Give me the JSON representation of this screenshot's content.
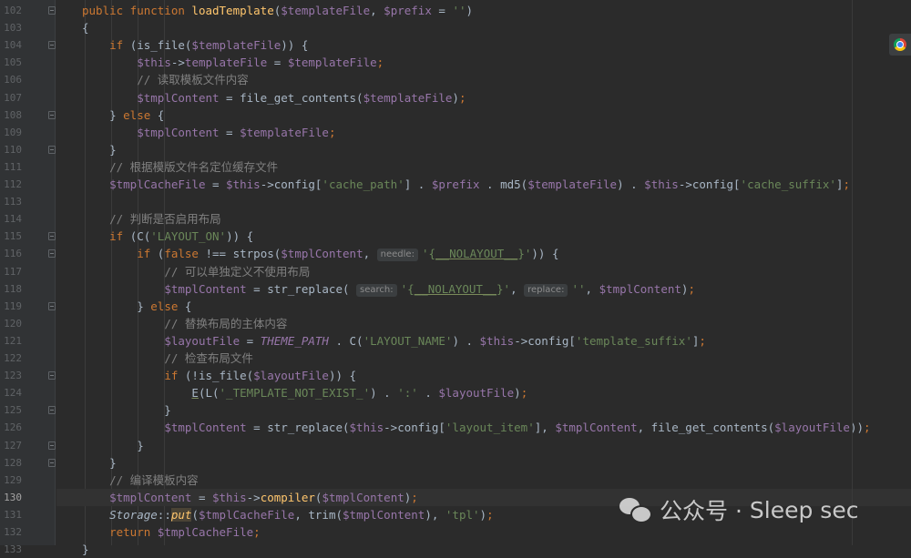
{
  "editor": {
    "current_line": "130",
    "lines": [
      {
        "num": "102",
        "fold": true,
        "tokens": [
          [
            "k",
            "public function "
          ],
          [
            "f",
            "loadTemplate"
          ],
          [
            "p",
            "("
          ],
          [
            "v",
            "$templateFile"
          ],
          [
            "p",
            ", "
          ],
          [
            "v",
            "$prefix"
          ],
          [
            "p",
            " = "
          ],
          [
            "s",
            "''"
          ],
          [
            "p",
            ")"
          ]
        ]
      },
      {
        "num": "103",
        "tokens": [
          [
            "p",
            "{"
          ]
        ]
      },
      {
        "num": "104",
        "fold": true,
        "tokens": [
          [
            "p",
            "    "
          ],
          [
            "k",
            "if "
          ],
          [
            "p",
            "(is_file("
          ],
          [
            "v",
            "$templateFile"
          ],
          [
            "p",
            ")) {"
          ]
        ]
      },
      {
        "num": "105",
        "tokens": [
          [
            "p",
            "        "
          ],
          [
            "v",
            "$this"
          ],
          [
            "p",
            "->"
          ],
          [
            "v",
            "templateFile"
          ],
          [
            "p",
            " = "
          ],
          [
            "v",
            "$templateFile"
          ],
          [
            "k",
            ";"
          ]
        ]
      },
      {
        "num": "106",
        "tokens": [
          [
            "p",
            "        "
          ],
          [
            "c",
            "// 读取模板文件内容"
          ]
        ]
      },
      {
        "num": "107",
        "tokens": [
          [
            "p",
            "        "
          ],
          [
            "v",
            "$tmplContent"
          ],
          [
            "p",
            " = file_get_contents("
          ],
          [
            "v",
            "$templateFile"
          ],
          [
            "p",
            ")"
          ],
          [
            "k",
            ";"
          ]
        ]
      },
      {
        "num": "108",
        "fold": true,
        "tokens": [
          [
            "p",
            "    } "
          ],
          [
            "k",
            "else "
          ],
          [
            "p",
            "{"
          ]
        ]
      },
      {
        "num": "109",
        "tokens": [
          [
            "p",
            "        "
          ],
          [
            "v",
            "$tmplContent"
          ],
          [
            "p",
            " = "
          ],
          [
            "v",
            "$templateFile"
          ],
          [
            "k",
            ";"
          ]
        ]
      },
      {
        "num": "110",
        "fold": true,
        "tokens": [
          [
            "p",
            "    }"
          ]
        ]
      },
      {
        "num": "111",
        "tokens": [
          [
            "p",
            "    "
          ],
          [
            "c",
            "// 根据模版文件名定位缓存文件"
          ]
        ]
      },
      {
        "num": "112",
        "tokens": [
          [
            "p",
            "    "
          ],
          [
            "v",
            "$tmplCacheFile"
          ],
          [
            "p",
            " = "
          ],
          [
            "v",
            "$this"
          ],
          [
            "p",
            "->config["
          ],
          [
            "s",
            "'cache_path'"
          ],
          [
            "p",
            "] . "
          ],
          [
            "v",
            "$prefix"
          ],
          [
            "p",
            " . md5("
          ],
          [
            "v",
            "$templateFile"
          ],
          [
            "p",
            ") . "
          ],
          [
            "v",
            "$this"
          ],
          [
            "p",
            "->config["
          ],
          [
            "s",
            "'cache_suffix'"
          ],
          [
            "p",
            "]"
          ],
          [
            "k",
            ";"
          ]
        ]
      },
      {
        "num": "113",
        "tokens": []
      },
      {
        "num": "114",
        "tokens": [
          [
            "p",
            "    "
          ],
          [
            "c",
            "// 判断是否启用布局"
          ]
        ]
      },
      {
        "num": "115",
        "fold": true,
        "tokens": [
          [
            "p",
            "    "
          ],
          [
            "k",
            "if "
          ],
          [
            "p",
            "(C("
          ],
          [
            "s",
            "'LAYOUT_ON'"
          ],
          [
            "p",
            ")) {"
          ]
        ]
      },
      {
        "num": "116",
        "fold": true,
        "tokens": [
          [
            "p",
            "        "
          ],
          [
            "k",
            "if "
          ],
          [
            "p",
            "("
          ],
          [
            "k",
            "false "
          ],
          [
            "p",
            "!== strpos("
          ],
          [
            "v",
            "$tmplContent"
          ],
          [
            "p",
            ", "
          ],
          [
            "h",
            "needle:"
          ],
          [
            "s",
            "'{"
          ],
          [
            "su",
            "__NOLAYOUT__"
          ],
          [
            "s",
            "}'"
          ],
          [
            "p",
            ")) {"
          ]
        ]
      },
      {
        "num": "117",
        "tokens": [
          [
            "p",
            "            "
          ],
          [
            "c",
            "// 可以单独定义不使用布局"
          ]
        ]
      },
      {
        "num": "118",
        "tokens": [
          [
            "p",
            "            "
          ],
          [
            "v",
            "$tmplContent"
          ],
          [
            "p",
            " = str_replace( "
          ],
          [
            "h",
            "search:"
          ],
          [
            "s",
            "'{"
          ],
          [
            "su",
            "__NOLAYOUT__"
          ],
          [
            "s",
            "}'"
          ],
          [
            "p",
            ", "
          ],
          [
            "h",
            "replace:"
          ],
          [
            "s",
            "''"
          ],
          [
            "p",
            ", "
          ],
          [
            "v",
            "$tmplContent"
          ],
          [
            "p",
            ")"
          ],
          [
            "k",
            ";"
          ]
        ]
      },
      {
        "num": "119",
        "fold": true,
        "tokens": [
          [
            "p",
            "        } "
          ],
          [
            "k",
            "else "
          ],
          [
            "p",
            "{"
          ]
        ]
      },
      {
        "num": "120",
        "tokens": [
          [
            "p",
            "            "
          ],
          [
            "c",
            "// 替换布局的主体内容"
          ]
        ]
      },
      {
        "num": "121",
        "tokens": [
          [
            "p",
            "            "
          ],
          [
            "v",
            "$layoutFile"
          ],
          [
            "p",
            " = "
          ],
          [
            "cn",
            "THEME_PATH"
          ],
          [
            "p",
            " . C("
          ],
          [
            "s",
            "'LAYOUT_NAME'"
          ],
          [
            "p",
            ") . "
          ],
          [
            "v",
            "$this"
          ],
          [
            "p",
            "->config["
          ],
          [
            "s",
            "'template_suffix'"
          ],
          [
            "p",
            "]"
          ],
          [
            "k",
            ";"
          ]
        ]
      },
      {
        "num": "122",
        "tokens": [
          [
            "p",
            "            "
          ],
          [
            "c",
            "// 检查布局文件"
          ]
        ]
      },
      {
        "num": "123",
        "fold": true,
        "tokens": [
          [
            "p",
            "            "
          ],
          [
            "k",
            "if "
          ],
          [
            "p",
            "(!is_file("
          ],
          [
            "v",
            "$layoutFile"
          ],
          [
            "p",
            ")) {"
          ]
        ]
      },
      {
        "num": "124",
        "tokens": [
          [
            "p",
            "                "
          ],
          [
            "pu",
            "E"
          ],
          [
            "p",
            "(L("
          ],
          [
            "s",
            "'_TEMPLATE_NOT_EXIST_'"
          ],
          [
            "p",
            ") . "
          ],
          [
            "s",
            "':'"
          ],
          [
            "p",
            " . "
          ],
          [
            "v",
            "$layoutFile"
          ],
          [
            "p",
            ")"
          ],
          [
            "k",
            ";"
          ]
        ]
      },
      {
        "num": "125",
        "fold": true,
        "tokens": [
          [
            "p",
            "            }"
          ]
        ]
      },
      {
        "num": "126",
        "tokens": [
          [
            "p",
            "            "
          ],
          [
            "v",
            "$tmplContent"
          ],
          [
            "p",
            " = str_replace("
          ],
          [
            "v",
            "$this"
          ],
          [
            "p",
            "->config["
          ],
          [
            "s",
            "'layout_item'"
          ],
          [
            "p",
            "], "
          ],
          [
            "v",
            "$tmplContent"
          ],
          [
            "p",
            ", file_get_contents("
          ],
          [
            "v",
            "$layoutFile"
          ],
          [
            "p",
            "))"
          ],
          [
            "k",
            ";"
          ]
        ]
      },
      {
        "num": "127",
        "fold": true,
        "tokens": [
          [
            "p",
            "        }"
          ]
        ]
      },
      {
        "num": "128",
        "fold": true,
        "tokens": [
          [
            "p",
            "    }"
          ]
        ]
      },
      {
        "num": "129",
        "tokens": [
          [
            "p",
            "    "
          ],
          [
            "c",
            "// 编译模板内容"
          ]
        ]
      },
      {
        "num": "130",
        "tokens": [
          [
            "p",
            "    "
          ],
          [
            "v",
            "$tmplContent"
          ],
          [
            "p",
            " = "
          ],
          [
            "v",
            "$this"
          ],
          [
            "p",
            "->"
          ],
          [
            "f",
            "compiler"
          ],
          [
            "p",
            "("
          ],
          [
            "v",
            "$tmplContent"
          ],
          [
            "p",
            ")"
          ],
          [
            "k",
            ";"
          ]
        ]
      },
      {
        "num": "131",
        "tokens": [
          [
            "p",
            "    "
          ],
          [
            "i",
            "Storage"
          ],
          [
            "p",
            "::"
          ],
          [
            "fh",
            "put"
          ],
          [
            "p",
            "("
          ],
          [
            "v",
            "$tmplCacheFile"
          ],
          [
            "p",
            ", trim("
          ],
          [
            "v",
            "$tmplContent"
          ],
          [
            "p",
            "), "
          ],
          [
            "s",
            "'tpl'"
          ],
          [
            "p",
            ")"
          ],
          [
            "k",
            ";"
          ]
        ]
      },
      {
        "num": "132",
        "tokens": [
          [
            "p",
            "    "
          ],
          [
            "k",
            "return "
          ],
          [
            "v",
            "$tmplCacheFile"
          ],
          [
            "k",
            ";"
          ]
        ]
      },
      {
        "num": "133",
        "tokens": [
          [
            "p",
            "}"
          ]
        ]
      }
    ]
  },
  "watermark": {
    "prefix": "公众号 · ",
    "name": "Sleep sec"
  },
  "browser_icon": "chrome-icon",
  "colors": {
    "background": "#2b2b2b",
    "keyword": "#cc7832",
    "function": "#ffc66d",
    "variable": "#9876aa",
    "string": "#6a8759",
    "comment": "#808080"
  }
}
